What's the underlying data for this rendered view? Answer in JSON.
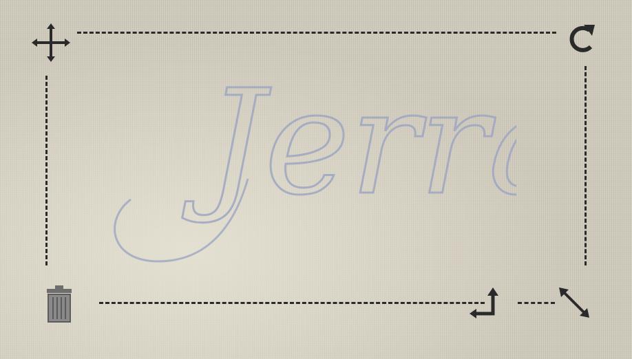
{
  "signature": {
    "text": "Jerrai",
    "ink_color": "#9ea6c2"
  },
  "colors": {
    "background": "#cfcabc",
    "outline": "#2a2a2a"
  },
  "icons": {
    "move": "move-arrows-icon",
    "rotate": "rotate-icon",
    "delete": "trash-icon",
    "stretch": "stretch-arrow-icon",
    "scale": "diagonal-resize-icon"
  }
}
